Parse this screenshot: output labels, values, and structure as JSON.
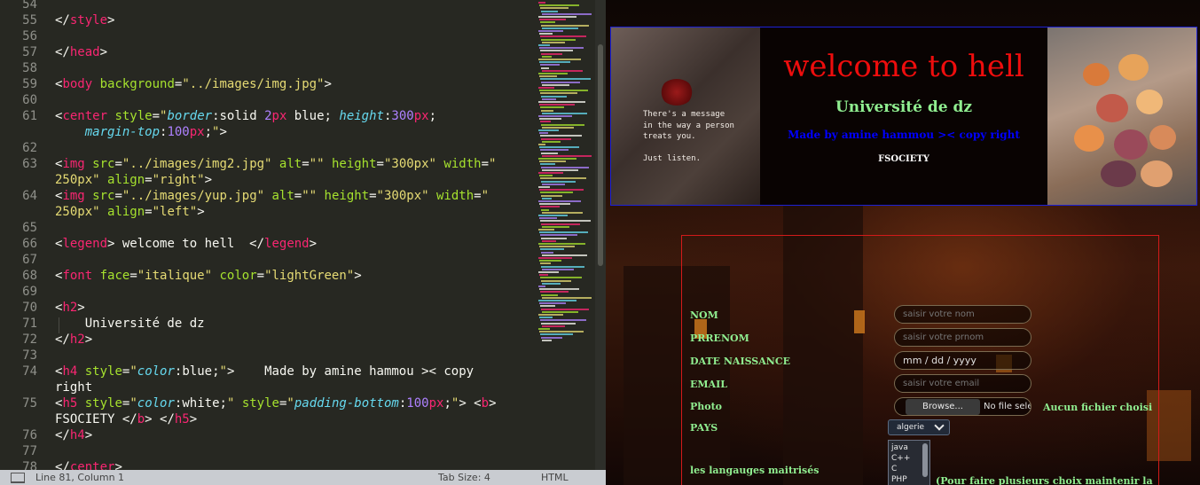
{
  "editor": {
    "lines": [
      {
        "num": "54",
        "tokens": []
      },
      {
        "num": "55",
        "tokens": [
          [
            "punc",
            "</"
          ],
          [
            "tag",
            "style"
          ],
          [
            "punc",
            ">"
          ]
        ]
      },
      {
        "num": "56",
        "tokens": []
      },
      {
        "num": "57",
        "tokens": [
          [
            "punc",
            "</"
          ],
          [
            "tag",
            "head"
          ],
          [
            "punc",
            ">"
          ]
        ]
      },
      {
        "num": "58",
        "tokens": []
      },
      {
        "num": "59",
        "tokens": [
          [
            "punc",
            "<"
          ],
          [
            "tag",
            "body"
          ],
          [
            "punc",
            " "
          ],
          [
            "attr",
            "background"
          ],
          [
            "punc",
            "="
          ],
          [
            "str",
            "\"../images/img.jpg\""
          ],
          [
            "punc",
            ">"
          ]
        ]
      },
      {
        "num": "60",
        "tokens": []
      },
      {
        "num": "61",
        "tokens": [
          [
            "punc",
            "<"
          ],
          [
            "tag",
            "center"
          ],
          [
            "punc",
            " "
          ],
          [
            "attr",
            "style"
          ],
          [
            "punc",
            "="
          ],
          [
            "str",
            "\""
          ],
          [
            "prop",
            "border"
          ],
          [
            "punc",
            ":solid "
          ],
          [
            "num",
            "2"
          ],
          [
            "tag",
            "px"
          ],
          [
            "punc",
            " blue; "
          ],
          [
            "prop",
            "height"
          ],
          [
            "punc",
            ":"
          ],
          [
            "num",
            "300"
          ],
          [
            "tag",
            "px"
          ],
          [
            "punc",
            ";"
          ]
        ]
      },
      {
        "num": "",
        "tokens": [
          [
            "punc",
            "    "
          ],
          [
            "prop",
            "margin-top"
          ],
          [
            "punc",
            ":"
          ],
          [
            "num",
            "100"
          ],
          [
            "tag",
            "px"
          ],
          [
            "punc",
            ";"
          ],
          [
            "str",
            "\""
          ],
          [
            "punc",
            ">"
          ]
        ]
      },
      {
        "num": "62",
        "tokens": []
      },
      {
        "num": "63",
        "tokens": [
          [
            "punc",
            "<"
          ],
          [
            "tag",
            "img"
          ],
          [
            "punc",
            " "
          ],
          [
            "attr",
            "src"
          ],
          [
            "punc",
            "="
          ],
          [
            "str",
            "\"../images/img2.jpg\""
          ],
          [
            "punc",
            " "
          ],
          [
            "attr",
            "alt"
          ],
          [
            "punc",
            "="
          ],
          [
            "str",
            "\"\""
          ],
          [
            "punc",
            " "
          ],
          [
            "attr",
            "height"
          ],
          [
            "punc",
            "="
          ],
          [
            "str",
            "\"300px\""
          ],
          [
            "punc",
            " "
          ],
          [
            "attr",
            "width"
          ],
          [
            "punc",
            "="
          ],
          [
            "str",
            "\""
          ]
        ]
      },
      {
        "num": "",
        "tokens": [
          [
            "str",
            "250px\""
          ],
          [
            "punc",
            " "
          ],
          [
            "attr",
            "align"
          ],
          [
            "punc",
            "="
          ],
          [
            "str",
            "\"right\""
          ],
          [
            "punc",
            ">"
          ]
        ]
      },
      {
        "num": "64",
        "tokens": [
          [
            "punc",
            "<"
          ],
          [
            "tag",
            "img"
          ],
          [
            "punc",
            " "
          ],
          [
            "attr",
            "src"
          ],
          [
            "punc",
            "="
          ],
          [
            "str",
            "\"../images/yup.jpg\""
          ],
          [
            "punc",
            " "
          ],
          [
            "attr",
            "alt"
          ],
          [
            "punc",
            "="
          ],
          [
            "str",
            "\"\""
          ],
          [
            "punc",
            " "
          ],
          [
            "attr",
            "height"
          ],
          [
            "punc",
            "="
          ],
          [
            "str",
            "\"300px\""
          ],
          [
            "punc",
            " "
          ],
          [
            "attr",
            "width"
          ],
          [
            "punc",
            "="
          ],
          [
            "str",
            "\""
          ]
        ]
      },
      {
        "num": "",
        "tokens": [
          [
            "str",
            "250px\""
          ],
          [
            "punc",
            " "
          ],
          [
            "attr",
            "align"
          ],
          [
            "punc",
            "="
          ],
          [
            "str",
            "\"left\""
          ],
          [
            "punc",
            ">"
          ]
        ]
      },
      {
        "num": "65",
        "tokens": []
      },
      {
        "num": "66",
        "tokens": [
          [
            "punc",
            "<"
          ],
          [
            "tag",
            "legend"
          ],
          [
            "punc",
            "> welcome to hell  </"
          ],
          [
            "tag",
            "legend"
          ],
          [
            "punc",
            ">"
          ]
        ]
      },
      {
        "num": "67",
        "tokens": []
      },
      {
        "num": "68",
        "tokens": [
          [
            "punc",
            "<"
          ],
          [
            "tag",
            "font"
          ],
          [
            "punc",
            " "
          ],
          [
            "attr",
            "face"
          ],
          [
            "punc",
            "="
          ],
          [
            "str",
            "\"italique\""
          ],
          [
            "punc",
            " "
          ],
          [
            "attr",
            "color"
          ],
          [
            "punc",
            "="
          ],
          [
            "str",
            "\"lightGreen\""
          ],
          [
            "punc",
            ">"
          ]
        ]
      },
      {
        "num": "69",
        "tokens": []
      },
      {
        "num": "70",
        "tokens": [
          [
            "punc",
            "<"
          ],
          [
            "tag",
            "h2"
          ],
          [
            "punc",
            ">"
          ]
        ]
      },
      {
        "num": "71",
        "tokens": [
          [
            "punc",
            "    Université de dz"
          ]
        ]
      },
      {
        "num": "72",
        "tokens": [
          [
            "punc",
            "</"
          ],
          [
            "tag",
            "h2"
          ],
          [
            "punc",
            ">"
          ]
        ]
      },
      {
        "num": "73",
        "tokens": []
      },
      {
        "num": "74",
        "tokens": [
          [
            "punc",
            "<"
          ],
          [
            "tag",
            "h4"
          ],
          [
            "punc",
            " "
          ],
          [
            "attr",
            "style"
          ],
          [
            "punc",
            "="
          ],
          [
            "str",
            "\""
          ],
          [
            "prop",
            "color"
          ],
          [
            "punc",
            ":blue;"
          ],
          [
            "str",
            "\""
          ],
          [
            "punc",
            ">    Made by amine hammou >< copy"
          ]
        ]
      },
      {
        "num": "",
        "tokens": [
          [
            "punc",
            "right"
          ]
        ]
      },
      {
        "num": "75",
        "tokens": [
          [
            "punc",
            "<"
          ],
          [
            "tag",
            "h5"
          ],
          [
            "punc",
            " "
          ],
          [
            "attr",
            "style"
          ],
          [
            "punc",
            "="
          ],
          [
            "str",
            "\""
          ],
          [
            "prop",
            "color"
          ],
          [
            "punc",
            ":white;"
          ],
          [
            "str",
            "\""
          ],
          [
            "punc",
            " "
          ],
          [
            "attr",
            "style"
          ],
          [
            "punc",
            "="
          ],
          [
            "str",
            "\""
          ],
          [
            "prop",
            "padding-bottom"
          ],
          [
            "punc",
            ":"
          ],
          [
            "num",
            "100"
          ],
          [
            "tag",
            "px"
          ],
          [
            "punc",
            ";"
          ],
          [
            "str",
            "\""
          ],
          [
            "punc",
            "> <"
          ],
          [
            "tag",
            "b"
          ],
          [
            "punc",
            ">"
          ]
        ]
      },
      {
        "num": "",
        "tokens": [
          [
            "punc",
            "FSOCIETY </"
          ],
          [
            "tag",
            "b"
          ],
          [
            "punc",
            "> </"
          ],
          [
            "tag",
            "h5"
          ],
          [
            "punc",
            ">"
          ]
        ]
      },
      {
        "num": "76",
        "tokens": [
          [
            "punc",
            "</"
          ],
          [
            "tag",
            "h4"
          ],
          [
            "punc",
            ">"
          ]
        ]
      },
      {
        "num": "77",
        "tokens": []
      },
      {
        "num": "78",
        "tokens": [
          [
            "punc",
            "</"
          ],
          [
            "tag",
            "center"
          ],
          [
            "punc",
            ">"
          ]
        ]
      }
    ]
  },
  "statusbar": {
    "position": "Line 81, Column 1",
    "tab_size": "Tab Size: 4",
    "syntax": "HTML"
  },
  "preview": {
    "image_left_quote": "There's a message\nin the way a person\ntreats you.\n\nJust listen.",
    "title": "welcome to hell",
    "subtitle": "Université de dz",
    "made_by": "Made by amine hammou >< copy right",
    "fsociety": "FSOCIETY",
    "form": {
      "nom_label": "NOM",
      "nom_placeholder": "saisir votre nom",
      "prenom_label": "PRRENOM",
      "prenom_placeholder": "saisir votre prnom",
      "date_label": "DATE NAISSANCE",
      "date_value": "mm / dd / yyyy",
      "email_label": "EMAIL",
      "email_placeholder": "saisir votre email",
      "photo_label": "Photo",
      "browse_label": "Browse...",
      "no_file_text": "No file sele",
      "no_file_note": "Aucun fichier choisi",
      "pays_label": "PAYS",
      "pays_selected": "algerie",
      "langs_label": "les langauges maitrisés",
      "langs_options": [
        "java",
        "C++",
        "C",
        "PHP"
      ],
      "langs_note": "(Pour faire plusieurs choix maintenir la"
    }
  },
  "colors": {
    "editor_bg": "#272822",
    "tag": "#f92672",
    "attr": "#a6e22e",
    "string": "#e6db74",
    "property": "#66d9ef",
    "number": "#ae81ff",
    "title_red": "#ee0d0d",
    "light_green": "#90ee90",
    "blue": "#0000ff"
  }
}
